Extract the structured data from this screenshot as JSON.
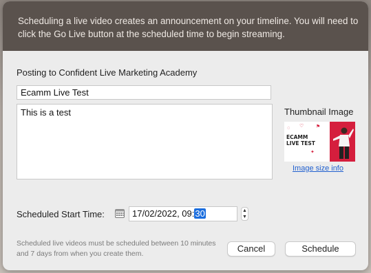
{
  "banner": {
    "text": "Scheduling a live video creates an announcement on your timeline. You will need to click the Go Live button at the scheduled time to begin streaming."
  },
  "form": {
    "posting_to": "Posting to Confident Live Marketing Academy",
    "title_value": "Ecamm Live Test",
    "description_value": "This is a test",
    "thumbnail_label": "Thumbnail Image",
    "thumbnail_text": "ECAMM LIVE TEST",
    "image_size_link": "Image size info",
    "start_time_label": "Scheduled Start Time:",
    "start_time_date_prefix": "17/02/2022, 09:",
    "start_time_selected": "30",
    "note": "Scheduled live videos must be scheduled between 10 minutes and 7 days from when you create them."
  },
  "buttons": {
    "cancel": "Cancel",
    "schedule": "Schedule"
  },
  "icons": {
    "calendar": "calendar-icon",
    "stepper": "stepper-icon"
  },
  "colors": {
    "banner_bg": "#5a524d",
    "accent": "#1a6dde",
    "thumb_red": "#d51e3d"
  }
}
